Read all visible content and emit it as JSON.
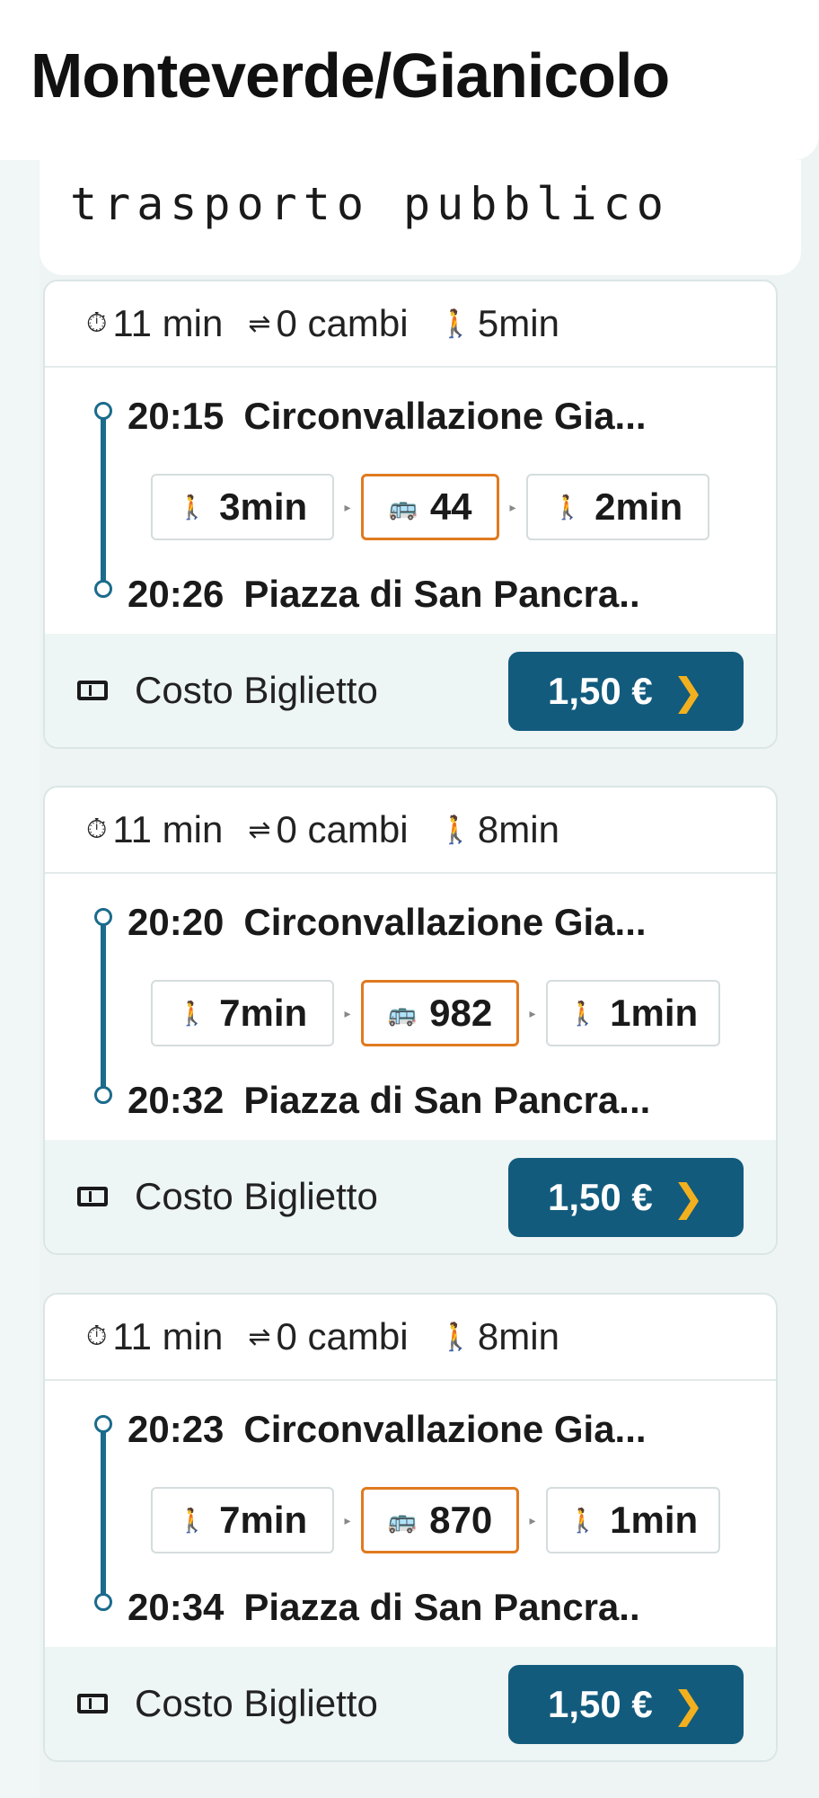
{
  "header": {
    "title": "Monteverde/Gianicolo",
    "subtitle": "trasporto pubblico"
  },
  "routes": [
    {
      "summary": {
        "duration": "11 min",
        "changes": "0 cambi",
        "walk": "5min"
      },
      "departure": {
        "time": "20:15",
        "stop": "Circonvallazione Gia..."
      },
      "arrival": {
        "time": "20:26",
        "stop": "Piazza di San Pancra.."
      },
      "legs": {
        "walk_before": "3min",
        "bus_line": "44",
        "walk_after": "2min"
      },
      "ticket_label": "Costo Biglietto",
      "price": "1,50 €"
    },
    {
      "summary": {
        "duration": "11 min",
        "changes": "0 cambi",
        "walk": "8min"
      },
      "departure": {
        "time": "20:20",
        "stop": "Circonvallazione Gia..."
      },
      "arrival": {
        "time": "20:32",
        "stop": "Piazza di San Pancra..."
      },
      "legs": {
        "walk_before": "7min",
        "bus_line": "982",
        "walk_after": "1min"
      },
      "ticket_label": "Costo Biglietto",
      "price": "1,50 €"
    },
    {
      "summary": {
        "duration": "11 min",
        "changes": "0 cambi",
        "walk": "8min"
      },
      "departure": {
        "time": "20:23",
        "stop": "Circonvallazione Gia..."
      },
      "arrival": {
        "time": "20:34",
        "stop": "Piazza di San Pancra.."
      },
      "legs": {
        "walk_before": "7min",
        "bus_line": "870",
        "walk_after": "1min"
      },
      "ticket_label": "Costo Biglietto",
      "price": "1,50 €"
    }
  ],
  "icons": {
    "clock": "clock-icon",
    "changes": "swap-arrows-icon",
    "walk": "walking-person-icon",
    "bus": "bus-icon",
    "ticket": "ticket-icon",
    "chevron": "chevron-right-icon"
  },
  "colors": {
    "accent": "#125b7d",
    "route_line": "#1b6b8c",
    "bus_border": "#e07a1f",
    "chevron": "#f2b01e"
  }
}
